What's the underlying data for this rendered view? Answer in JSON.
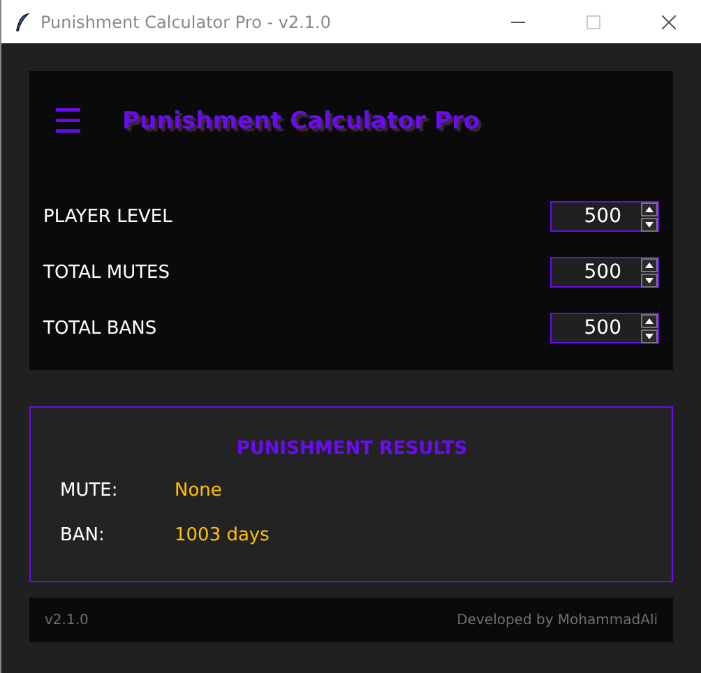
{
  "window": {
    "title": "Punishment Calculator Pro - v2.1.0"
  },
  "header": {
    "menu_glyph": "☰",
    "title": "Punishment Calculator Pro"
  },
  "inputs": [
    {
      "label": "PLAYER LEVEL",
      "value": "500"
    },
    {
      "label": "TOTAL MUTES",
      "value": "500"
    },
    {
      "label": "TOTAL BANS",
      "value": "500"
    }
  ],
  "results": {
    "title": "PUNISHMENT RESULTS",
    "rows": [
      {
        "label": "MUTE:",
        "value": "None"
      },
      {
        "label": "BAN:",
        "value": "1003 days"
      }
    ]
  },
  "footer": {
    "version": "v2.1.0",
    "credit": "Developed by MohammadAli"
  }
}
